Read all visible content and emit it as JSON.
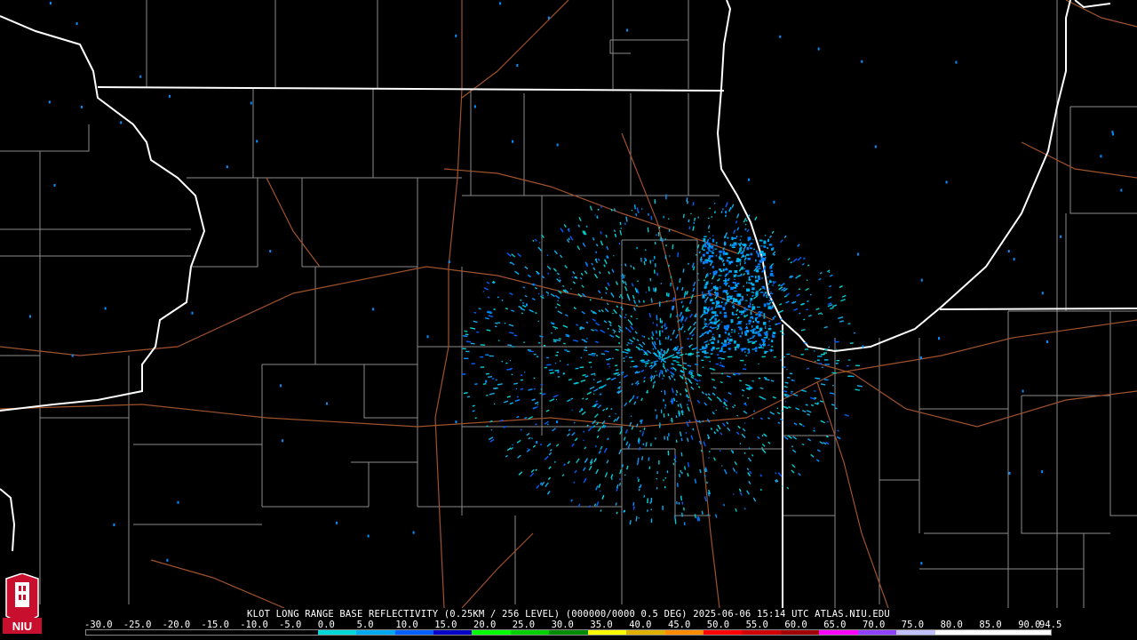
{
  "caption": "KLOT LONG RANGE BASE REFLECTIVITY (0.25KM / 256 LEVEL) (000000/0000 0.5 DEG) 2025-06-06 15:14 UTC  ATLAS.NIU.EDU",
  "logo_text": "NIU",
  "colors": {
    "background": "#000000",
    "state_border": "#ffffff",
    "county_line": "#8c8c8c",
    "highway": "#a0522d",
    "logo_red": "#c8102e"
  },
  "legend": {
    "ticks": [
      "-30.0",
      "-25.0",
      "-20.0",
      "-15.0",
      "-10.0",
      "-5.0",
      "0.0",
      "5.0",
      "10.0",
      "15.0",
      "20.0",
      "25.0",
      "30.0",
      "35.0",
      "40.0",
      "45.0",
      "50.0",
      "55.0",
      "60.0",
      "65.0",
      "70.0",
      "75.0",
      "80.0",
      "85.0",
      "90.0",
      "94.5"
    ],
    "colors": [
      "#000000",
      "#000000",
      "#000000",
      "#000000",
      "#000000",
      "#000000",
      "#00d8d8",
      "#00a8f0",
      "#0060ff",
      "#0000c8",
      "#00ff00",
      "#00d000",
      "#008c00",
      "#ffff00",
      "#e0b000",
      "#ff8c00",
      "#ff0000",
      "#d00000",
      "#a00000",
      "#ff00ff",
      "#9040ff",
      "#c0c0ff",
      "#ffffff",
      "#ffffff",
      "#ffffff"
    ]
  }
}
